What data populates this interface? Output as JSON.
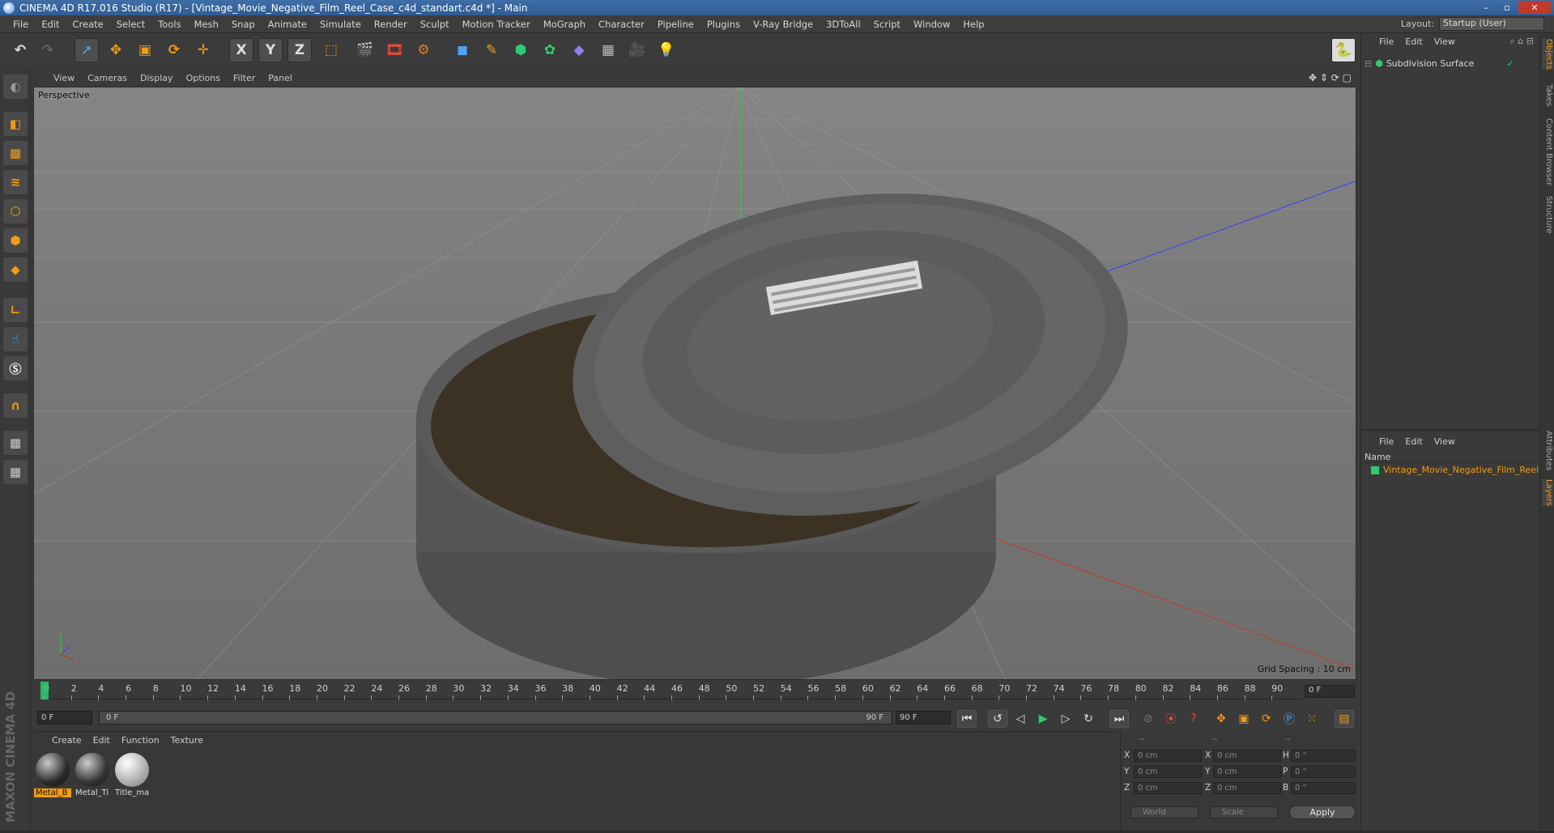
{
  "window": {
    "title": "CINEMA 4D R17.016 Studio (R17) - [Vintage_Movie_Negative_Film_Reel_Case_c4d_standart.c4d *] - Main",
    "buttons": [
      "–",
      "▫",
      "✕"
    ]
  },
  "menubar": {
    "items": [
      "File",
      "Edit",
      "Create",
      "Select",
      "Tools",
      "Mesh",
      "Snap",
      "Animate",
      "Simulate",
      "Render",
      "Sculpt",
      "Motion Tracker",
      "MoGraph",
      "Character",
      "Pipeline",
      "Plugins",
      "V-Ray Bridge",
      "3DToAll",
      "Script",
      "Window",
      "Help"
    ],
    "layout_label": "Layout:",
    "layout_value": "Startup (User)"
  },
  "toolbar": {
    "axis_x": "X",
    "axis_y": "Y",
    "axis_z": "Z"
  },
  "viewport": {
    "menu": [
      "View",
      "Cameras",
      "Display",
      "Options",
      "Filter",
      "Panel"
    ],
    "label": "Perspective",
    "grid_spacing": "Grid Spacing : 10 cm"
  },
  "timeline": {
    "ticks": [
      "0",
      "2",
      "4",
      "6",
      "8",
      "10",
      "12",
      "14",
      "16",
      "18",
      "20",
      "22",
      "24",
      "26",
      "28",
      "30",
      "32",
      "34",
      "36",
      "38",
      "40",
      "42",
      "44",
      "46",
      "48",
      "50",
      "52",
      "54",
      "56",
      "58",
      "60",
      "62",
      "64",
      "66",
      "68",
      "70",
      "72",
      "74",
      "76",
      "78",
      "80",
      "82",
      "84",
      "86",
      "88",
      "90"
    ],
    "current_frame": "0 F",
    "start_field": "0 F",
    "range_start": "0 F",
    "range_end": "90 F",
    "end_field": "90 F"
  },
  "materials": {
    "menu": [
      "Create",
      "Edit",
      "Function",
      "Texture"
    ],
    "items": [
      {
        "name": "Metal_B",
        "selected": true
      },
      {
        "name": "Metal_Ti",
        "selected": false
      },
      {
        "name": "Title_ma",
        "selected": false
      }
    ]
  },
  "coordinates": {
    "header": [
      "--",
      "--",
      "--"
    ],
    "rows": [
      {
        "a": "X",
        "av": "0 cm",
        "b": "X",
        "bv": "0 cm",
        "c": "H",
        "cv": "0 °"
      },
      {
        "a": "Y",
        "av": "0 cm",
        "b": "Y",
        "bv": "0 cm",
        "c": "P",
        "cv": "0 °"
      },
      {
        "a": "Z",
        "av": "0 cm",
        "b": "Z",
        "bv": "0 cm",
        "c": "B",
        "cv": "0 °"
      }
    ],
    "mode": "World",
    "scale": "Scale",
    "apply": "Apply"
  },
  "object_manager": {
    "menu": [
      "File",
      "Edit",
      "View"
    ],
    "object": "Subdivision Surface"
  },
  "layer_manager": {
    "menu": [
      "File",
      "Edit",
      "View"
    ],
    "column": "Name",
    "object": "Vintage_Movie_Negative_Film_Reel"
  },
  "side_tabs": [
    "Objects",
    "Takes",
    "Content Browser",
    "Structure",
    "Attributes",
    "Layers"
  ],
  "branding": "MAXON CINEMA 4D",
  "colors": {
    "accent": "#f39c12",
    "title_bar": "#3f6fa8"
  }
}
